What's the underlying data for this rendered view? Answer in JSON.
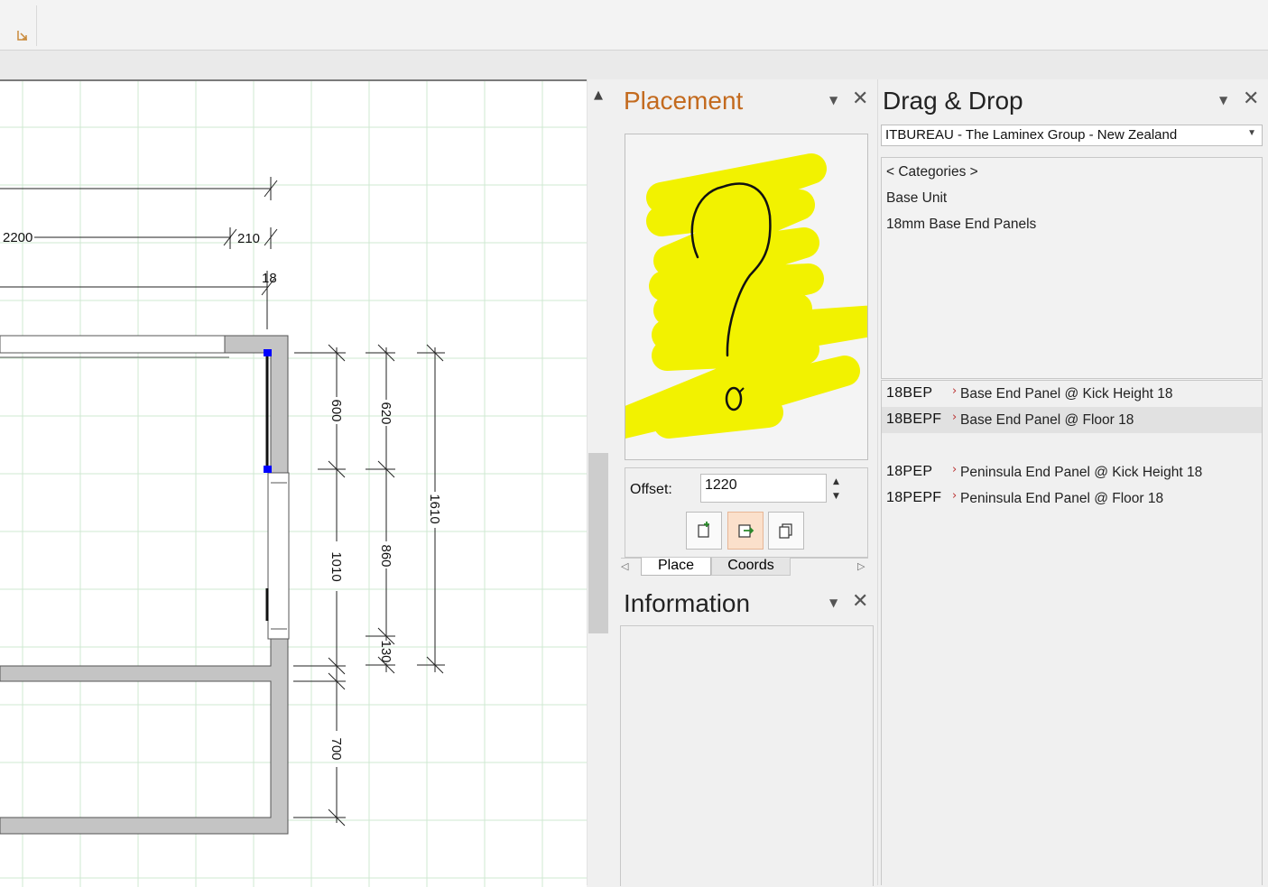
{
  "panels": {
    "placement": {
      "title": "Placement"
    },
    "information": {
      "title": "Information"
    },
    "drag_drop": {
      "title": "Drag & Drop"
    }
  },
  "placement": {
    "offset_label": "Offset:",
    "offset_value": "1220",
    "tabs": [
      "Place",
      "Coords"
    ]
  },
  "drag_drop": {
    "catalog": "ITBUREAU - The Laminex Group - New Zealand",
    "categories": [
      "< Categories >",
      "Base Unit",
      "18mm Base End Panels"
    ],
    "items": [
      {
        "code": "18BEP",
        "desc": "Base End Panel @ Kick Height 18",
        "selected": false
      },
      {
        "code": "18BEPF",
        "desc": "Base End Panel @ Floor 18",
        "selected": true
      },
      {
        "code": "18PEP",
        "desc": "Peninsula End Panel @ Kick Height 18",
        "selected": false
      },
      {
        "code": "18PEPF",
        "desc": "Peninsula End Panel @ Floor 18",
        "selected": false
      }
    ]
  },
  "drawing": {
    "dimensions": [
      "2200",
      "210",
      "18",
      "600",
      "620",
      "1610",
      "1010",
      "860",
      "130",
      "700"
    ]
  },
  "icons": [
    "dialog-launcher-icon",
    "scroll-up-icon",
    "pin-icon",
    "close-icon",
    "insert-icon",
    "replace-icon",
    "copy-icon",
    "dropdown-arrow-icon"
  ],
  "colors": {
    "placement_title": "#c36a1e",
    "handle": "#0000ff",
    "highlight": "#f2f200",
    "grid": "#cfe9d2"
  }
}
